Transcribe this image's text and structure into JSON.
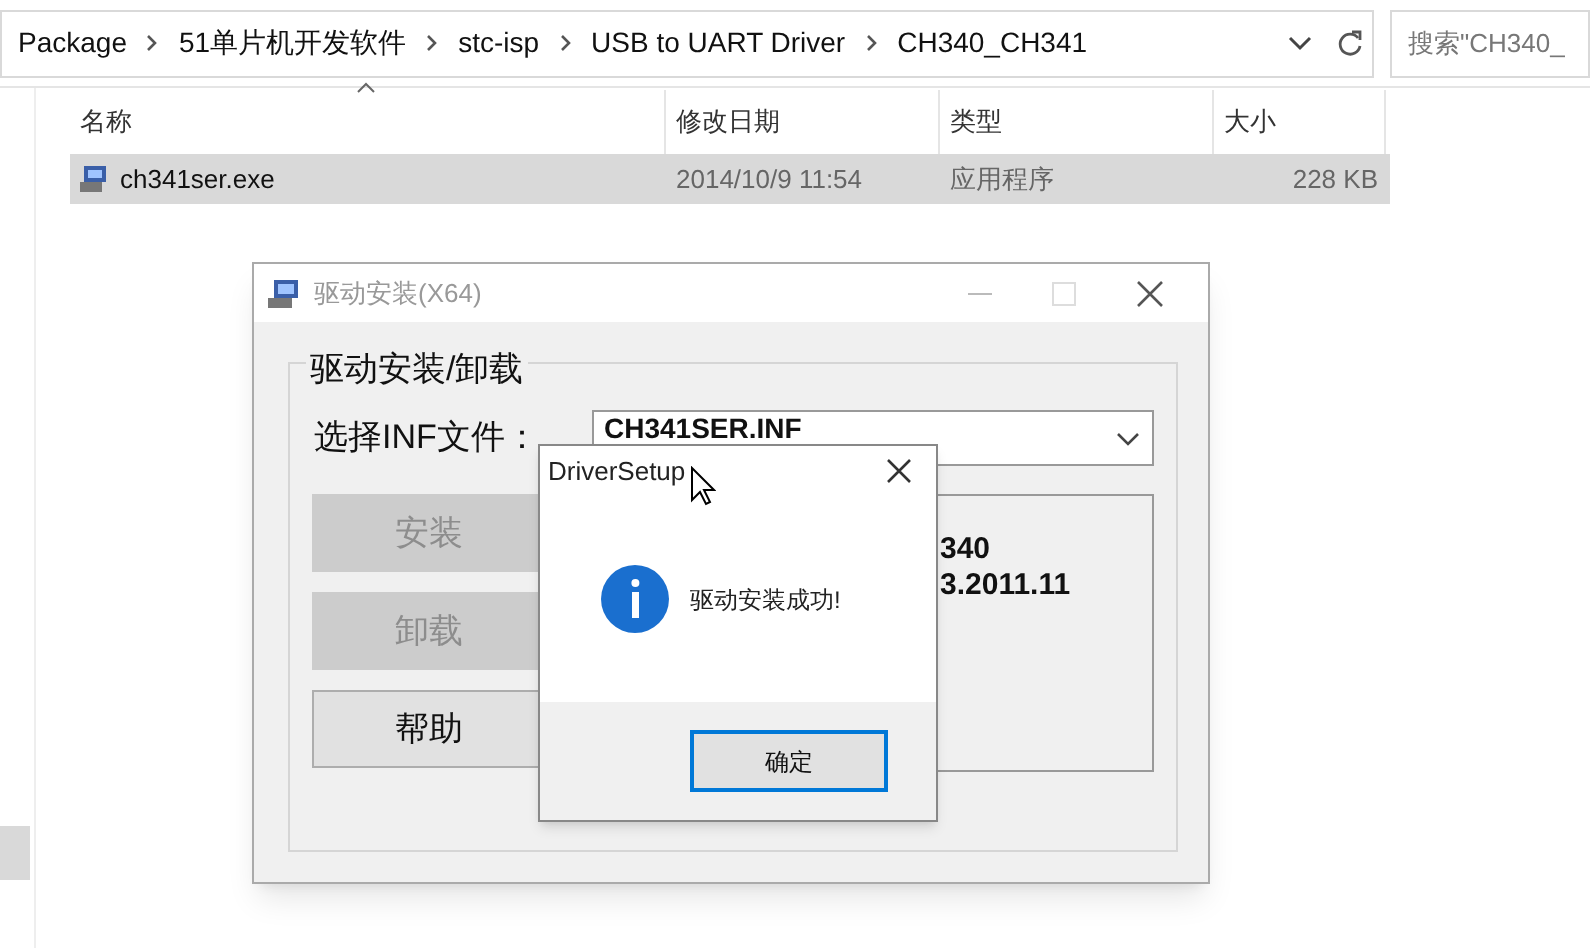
{
  "explorer": {
    "breadcrumb": [
      "Package",
      "51单片机开发软件",
      "stc-isp",
      "USB to UART Driver",
      "CH340_CH341"
    ],
    "search": {
      "placeholder": "搜索\"CH340_"
    },
    "columns": [
      "名称",
      "修改日期",
      "类型",
      "大小"
    ],
    "files": [
      {
        "name": "ch341ser.exe",
        "modified": "2014/10/9 11:54",
        "type": "应用程序",
        "size": "228 KB",
        "selected": true
      }
    ]
  },
  "installer": {
    "title": "驱动安装(X64)",
    "group_title": "驱动安装/卸载",
    "inf_label": "选择INF文件：",
    "inf_value": "CH341SER.INF",
    "buttons": [
      {
        "label": "安装",
        "disabled": true
      },
      {
        "label": "卸载",
        "disabled": true
      },
      {
        "label": "帮助",
        "disabled": false
      }
    ],
    "info_lines": [
      "340",
      "3.2011.11"
    ]
  },
  "message": {
    "title": "DriverSetup",
    "text": "驱动安装成功!",
    "ok": "确定"
  }
}
